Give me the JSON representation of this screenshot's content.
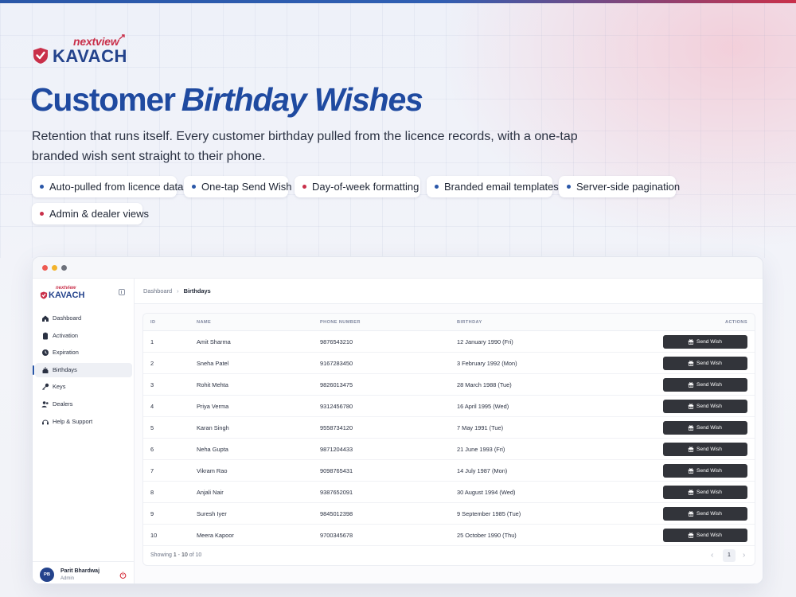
{
  "brand": {
    "nextview": "nextview",
    "kavach": "KAVACH"
  },
  "hero": {
    "title_main": "Customer",
    "title_accent": "Birthday Wishes",
    "subtitle": "Retention that runs itself. Every customer birthday pulled from the licence records, with a one-tap branded wish sent straight to their phone."
  },
  "features": [
    {
      "label": "Auto-pulled from licence data",
      "dot": "#2a57a8"
    },
    {
      "label": "One-tap Send Wish",
      "dot": "#2a57a8"
    },
    {
      "label": "Day-of-week formatting",
      "dot": "#c9304a"
    },
    {
      "label": "Branded email templates",
      "dot": "#2a57a8"
    },
    {
      "label": "Server-side pagination",
      "dot": "#2a57a8"
    },
    {
      "label": "Admin & dealer views",
      "dot": "#c9304a"
    }
  ],
  "colors": {
    "brand_blue": "#24438c",
    "brand_red": "#c9304a",
    "accent_blue": "#1f4aa0",
    "button_dark": "#32343a"
  },
  "app": {
    "sidebar": {
      "brand": {
        "nextview": "nextview",
        "kavach": "KAVACH"
      },
      "items": [
        {
          "label": "Dashboard",
          "icon": "home-icon",
          "active": false
        },
        {
          "label": "Activation",
          "icon": "clipboard-icon",
          "active": false
        },
        {
          "label": "Expiration",
          "icon": "clock-icon",
          "active": false
        },
        {
          "label": "Birthdays",
          "icon": "cake-icon",
          "active": true
        },
        {
          "label": "Keys",
          "icon": "key-icon",
          "active": false
        },
        {
          "label": "Dealers",
          "icon": "users-icon",
          "active": false
        },
        {
          "label": "Help & Support",
          "icon": "headset-icon",
          "active": false
        }
      ],
      "user": {
        "initials": "PB",
        "name": "Parit Bhardwaj",
        "role": "Admin"
      }
    },
    "breadcrumb": {
      "parent": "Dashboard",
      "separator": "›",
      "current": "Birthdays"
    },
    "table": {
      "columns": [
        "ID",
        "NAME",
        "PHONE NUMBER",
        "BIRTHDAY",
        "ACTIONS"
      ],
      "action_label": "Send Wish",
      "rows": [
        {
          "id": "1",
          "name": "Amit Sharma",
          "phone": "9876543210",
          "birthday": "12 January 1990 (Fri)"
        },
        {
          "id": "2",
          "name": "Sneha Patel",
          "phone": "9167283450",
          "birthday": "3 February 1992 (Mon)"
        },
        {
          "id": "3",
          "name": "Rohit Mehta",
          "phone": "9826013475",
          "birthday": "28 March 1988 (Tue)"
        },
        {
          "id": "4",
          "name": "Priya Verma",
          "phone": "9312456780",
          "birthday": "16 April 1995 (Wed)"
        },
        {
          "id": "5",
          "name": "Karan Singh",
          "phone": "9558734120",
          "birthday": "7 May 1991 (Tue)"
        },
        {
          "id": "6",
          "name": "Neha Gupta",
          "phone": "9871204433",
          "birthday": "21 June 1993 (Fri)"
        },
        {
          "id": "7",
          "name": "Vikram Rao",
          "phone": "9098765431",
          "birthday": "14 July 1987 (Mon)"
        },
        {
          "id": "8",
          "name": "Anjali Nair",
          "phone": "9387652091",
          "birthday": "30 August 1994 (Wed)"
        },
        {
          "id": "9",
          "name": "Suresh Iyer",
          "phone": "9845012398",
          "birthday": "9 September 1985 (Tue)"
        },
        {
          "id": "10",
          "name": "Meera Kapoor",
          "phone": "9700345678",
          "birthday": "25 October 1990 (Thu)"
        }
      ]
    },
    "pagination": {
      "showing_prefix": "Showing",
      "range_start": "1",
      "range_dash": "-",
      "range_end": "10",
      "of_word": "of",
      "total": "10",
      "current_page": "1",
      "prev": "‹",
      "next": "›"
    }
  }
}
